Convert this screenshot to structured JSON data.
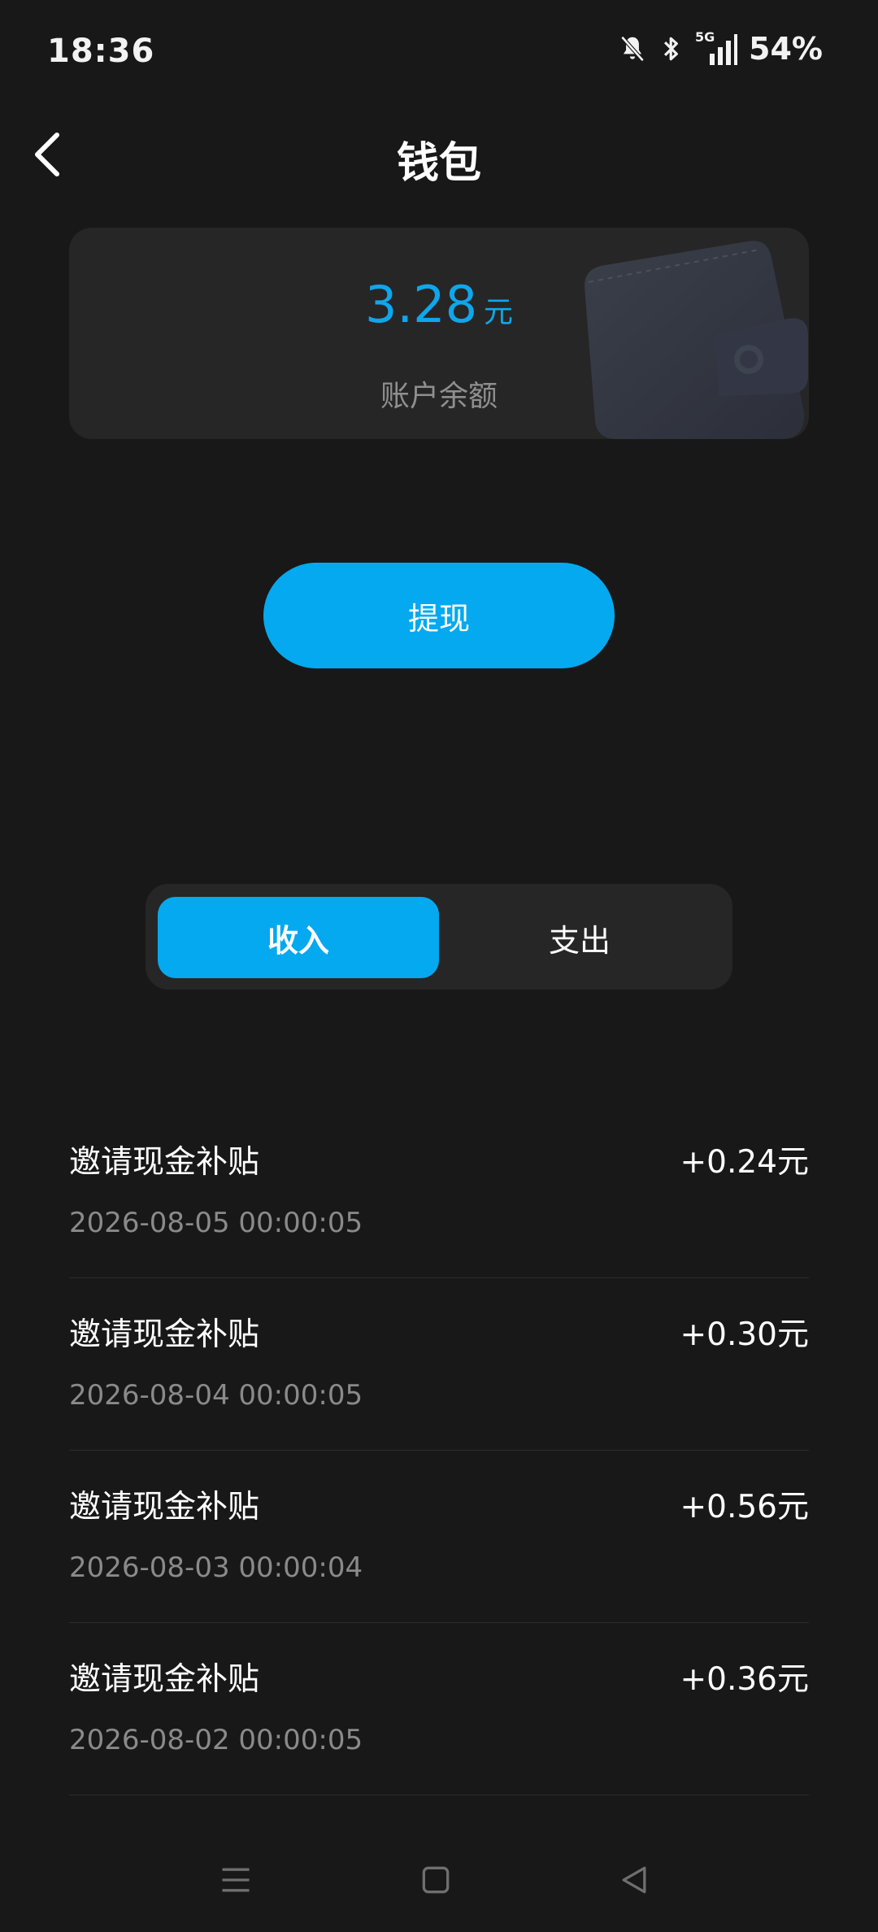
{
  "status_bar": {
    "time": "18:36",
    "network": "5G",
    "battery": "54%",
    "icons": [
      "bell-muted-icon",
      "bluetooth-icon",
      "signal-5g-icon"
    ]
  },
  "header": {
    "title": "钱包",
    "back_icon": "chevron-left-icon"
  },
  "balance": {
    "amount": "3.28",
    "unit": "元",
    "label": "账户余额",
    "accent_color": "#0ea7ec"
  },
  "withdraw_button": {
    "label": "提现",
    "color": "#05a9ef"
  },
  "tabs": [
    {
      "label": "收入",
      "active": true
    },
    {
      "label": "支出",
      "active": false
    }
  ],
  "transactions": [
    {
      "title": "邀请现金补贴",
      "amount": "+0.24元",
      "time": "2026-08-05 00:00:05"
    },
    {
      "title": "邀请现金补贴",
      "amount": "+0.30元",
      "time": "2026-08-04 00:00:05"
    },
    {
      "title": "邀请现金补贴",
      "amount": "+0.56元",
      "time": "2026-08-03 00:00:04"
    },
    {
      "title": "邀请现金补贴",
      "amount": "+0.36元",
      "time": "2026-08-02 00:00:05"
    }
  ],
  "nav_bar": {
    "icons": [
      "menu-icon",
      "home-square-icon",
      "back-triangle-icon"
    ]
  }
}
